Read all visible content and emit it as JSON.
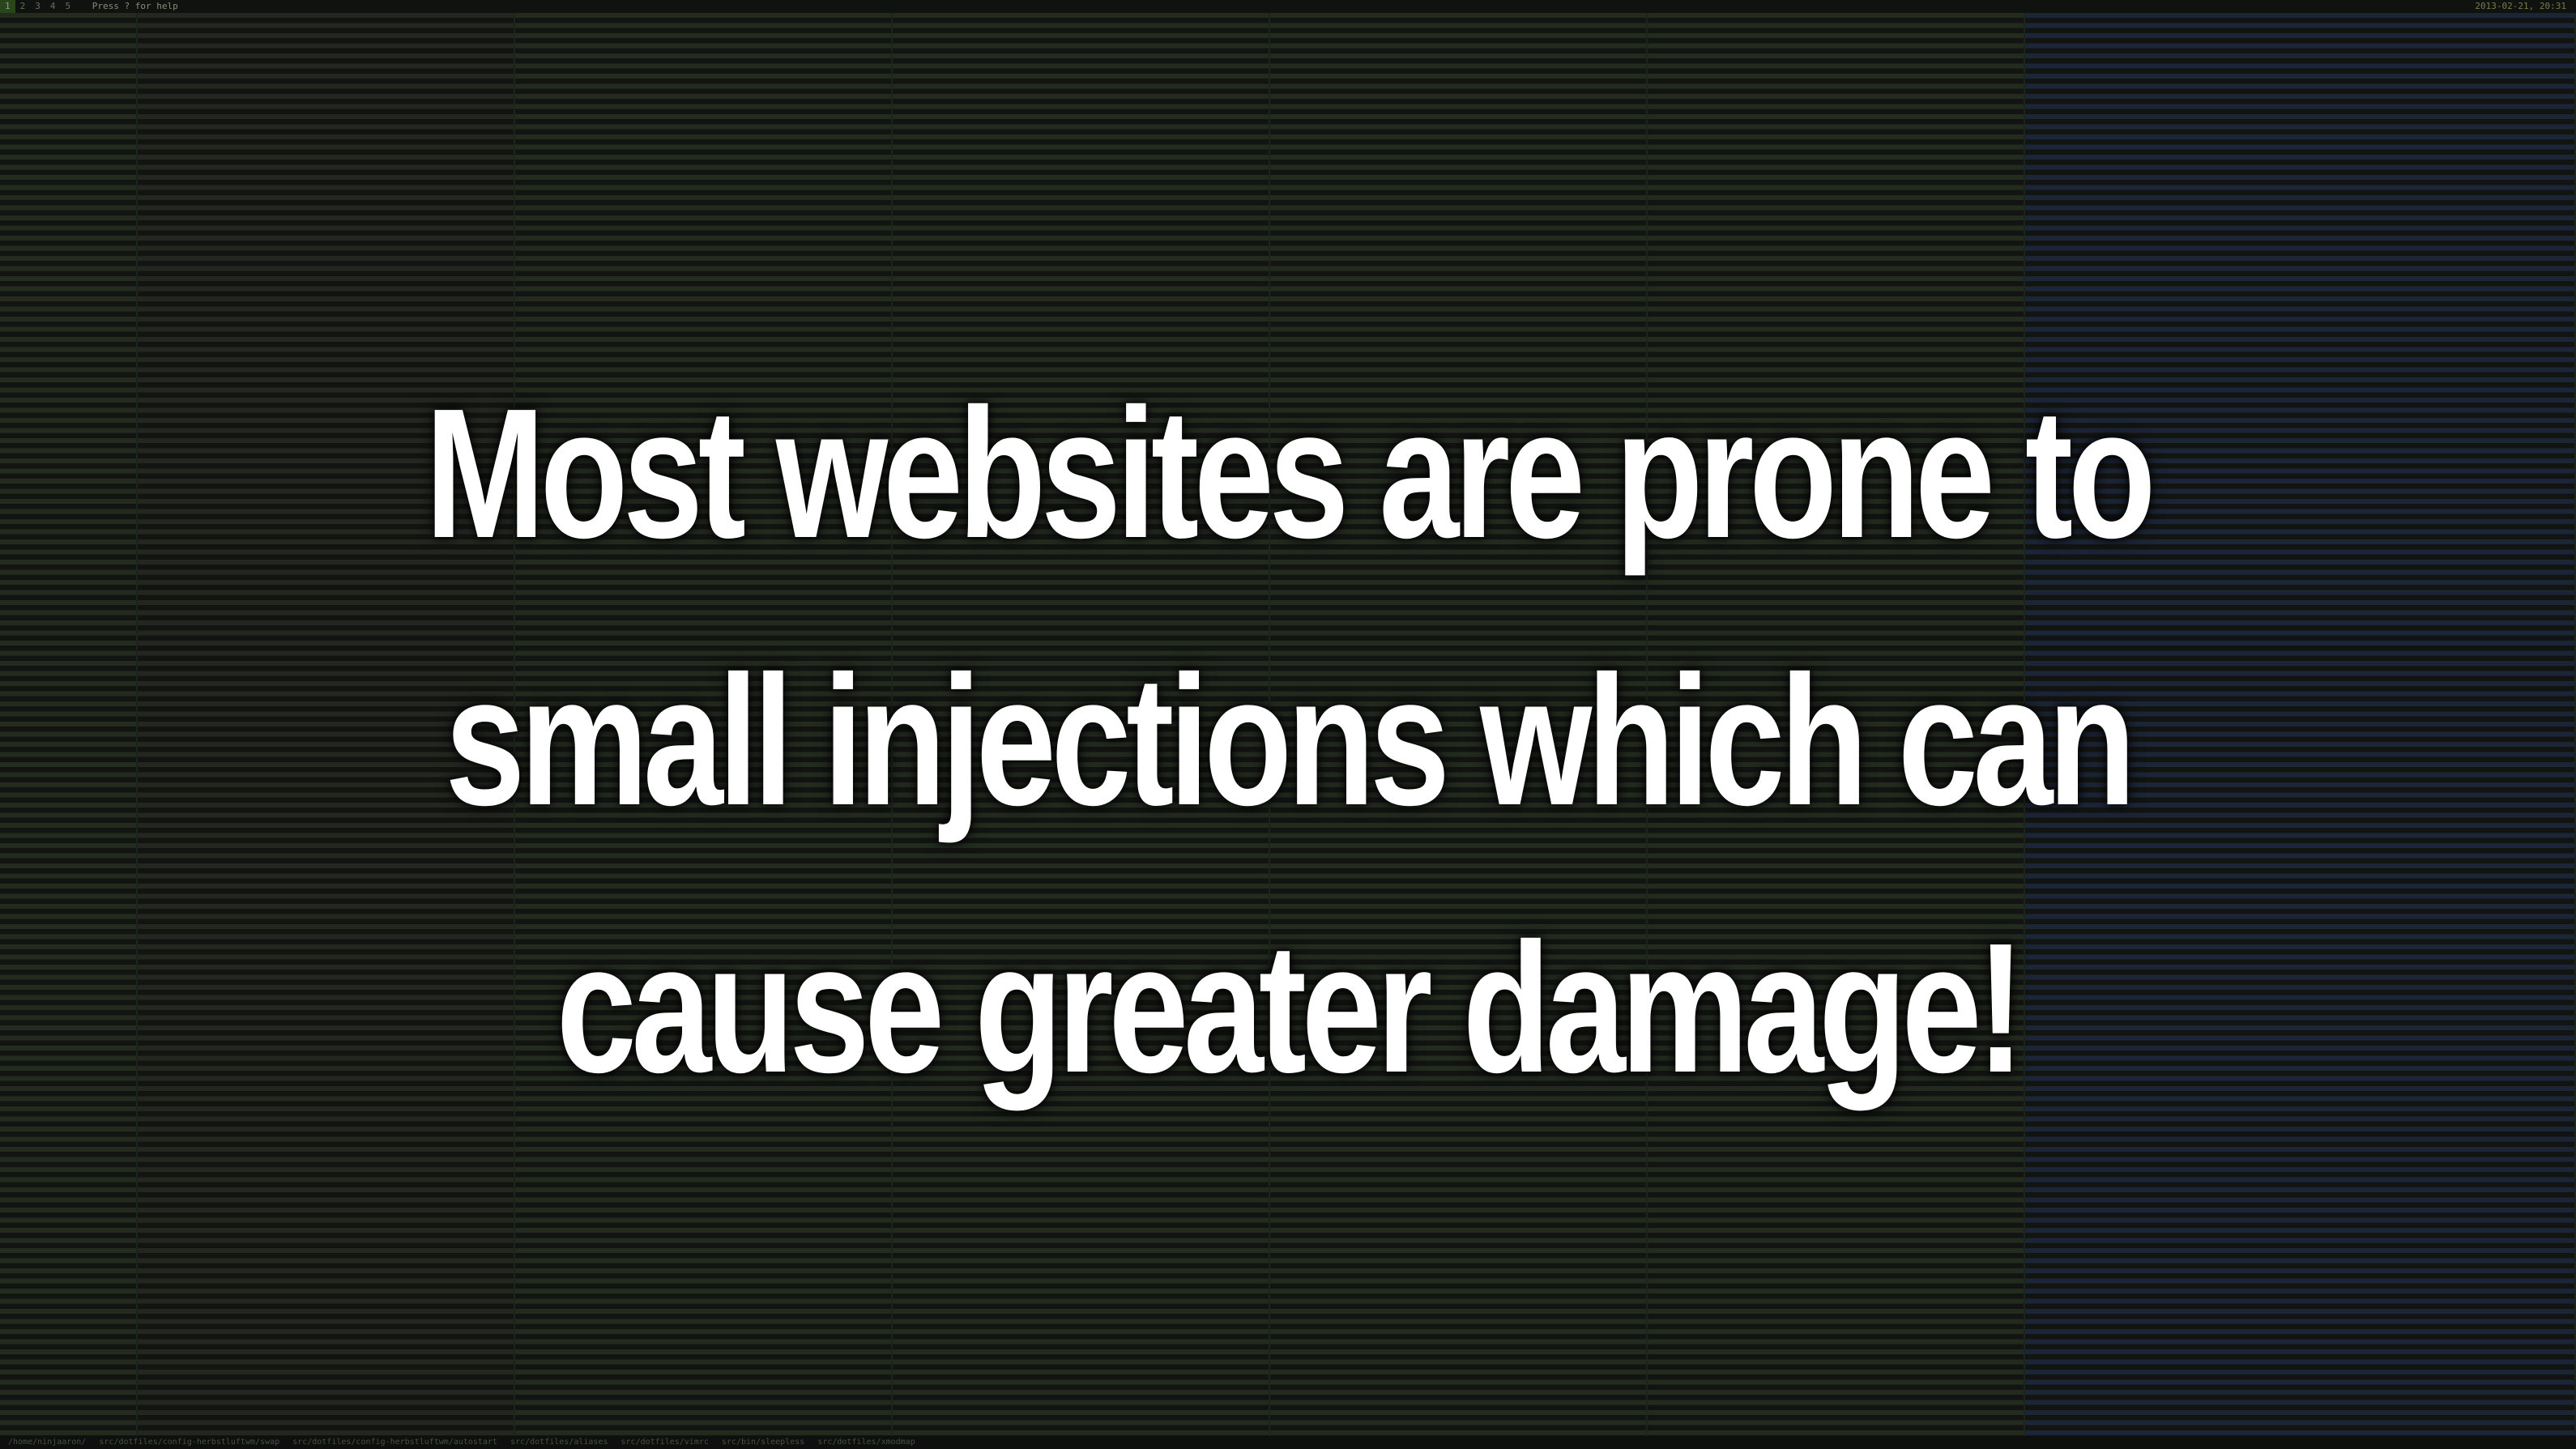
{
  "topbar": {
    "workspaces": [
      "1",
      "2",
      "3",
      "4",
      "5"
    ],
    "help_hint": "Press ? for help",
    "clock": "2013-02-21, 20:31"
  },
  "panes": [
    {
      "path": "/home/ninjaaron/"
    },
    {
      "path": "src/dotfiles/config-herbstluftwm/swap"
    },
    {
      "path": "src/dotfiles/config-herbstluftwm/autostart"
    },
    {
      "path": "src/dotfiles/aliases"
    },
    {
      "path": "src/dotfiles/vimrc"
    },
    {
      "path": "src/bin/sleepless"
    },
    {
      "path": "src/dotfiles/xmodmap"
    }
  ],
  "headline": {
    "line1": "Most websites are prone to",
    "line2": "small injections which can",
    "line3": "cause greater damage!"
  },
  "colors": {
    "background": "#1d1f1d",
    "headline_text": "#ffffff",
    "terminal_green": "#6f8f5a",
    "terminal_blue": "#4a6fb8"
  }
}
